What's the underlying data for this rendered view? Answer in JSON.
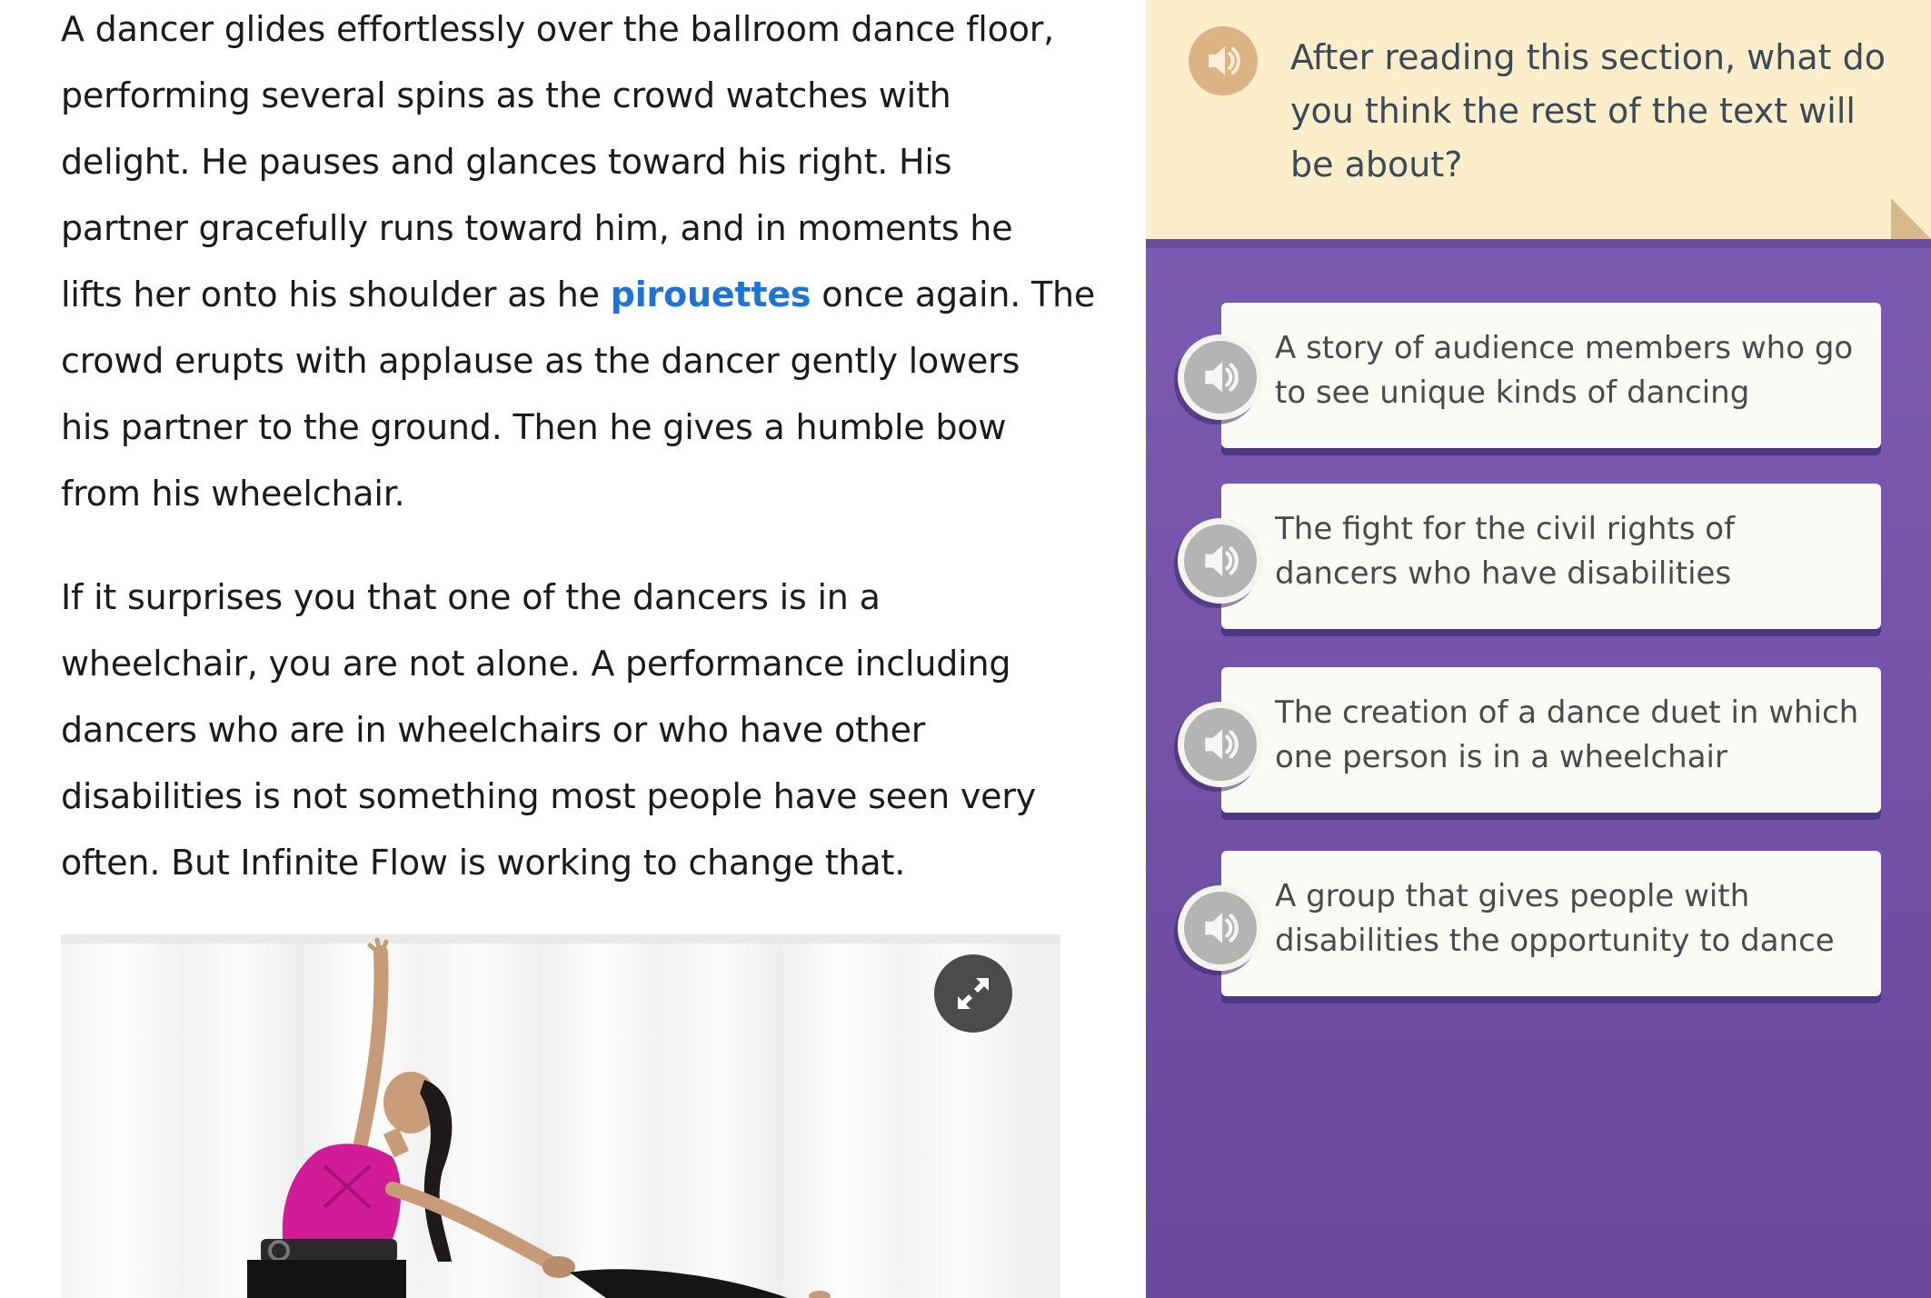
{
  "reading": {
    "paragraph1": {
      "line1": "A dancer glides effortlessly over the ballroom dance floor,",
      "line2": "performing several spins as the crowd watches with",
      "line3": "delight. He pauses and glances toward his right. His",
      "line4": "partner gracefully runs toward him, and in moments he",
      "line5_before": "lifts her onto his shoulder as he ",
      "line5_vocab": "pirouettes",
      "line5_after": " once again. The",
      "line6": "crowd erupts with applause as the dancer gently lowers",
      "line7": "his partner to the ground. Then he gives a humble bow",
      "line8": "from his wheelchair."
    },
    "paragraph2": {
      "line1": "If it surprises you that one of the dancers is in a",
      "line2": "wheelchair, you are not alone. A performance including",
      "line3": "dancers who are in wheelchairs or who have other",
      "line4": "disabilities is not something most people have seen very",
      "line5": "often. But Infinite Flow is working to change that."
    },
    "photo_icon": "expand-arrows-icon"
  },
  "question": {
    "prompt": "After reading this section, what do you think the rest of the text will be about?",
    "audio_icon": "speaker-icon",
    "choices": [
      {
        "label": "A story of audience members who go to see unique kinds of dancing"
      },
      {
        "label": "The fight for the civil rights of dancers who have disabilities"
      },
      {
        "label": "The creation of a dance duet in which one person is in a wheelchair"
      },
      {
        "label": "A group that gives people with disabilities the opportunity to dance"
      }
    ]
  },
  "colors": {
    "vocab_link": "#1f73d6",
    "panel_purple": "#7452a8",
    "prompt_bg": "#fdeecb",
    "choice_bg": "#fbfbf6"
  }
}
